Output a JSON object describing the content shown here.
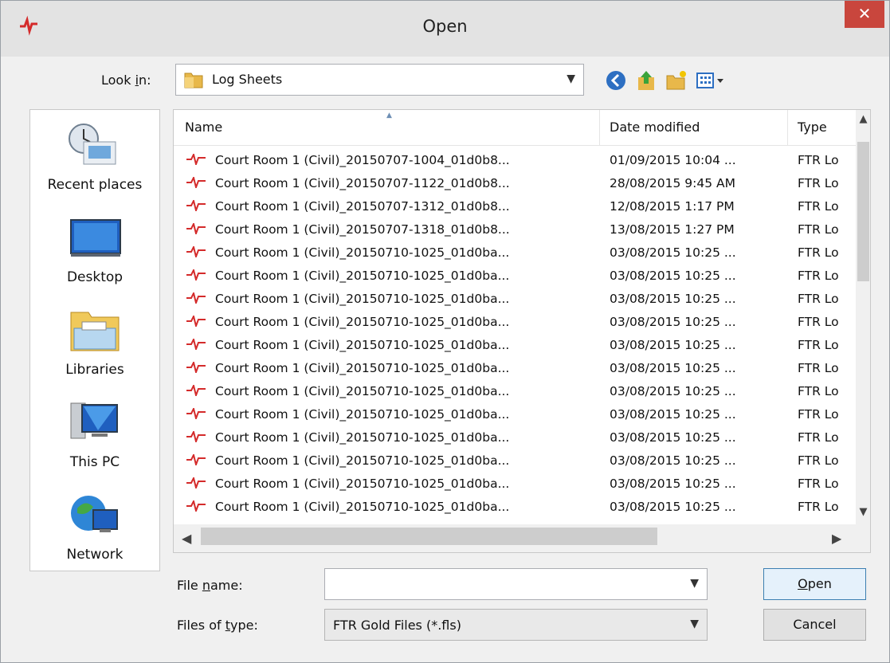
{
  "window": {
    "title": "Open",
    "close_label": "✕"
  },
  "look_in": {
    "label_pre": "Look ",
    "label_accel": "i",
    "label_post": "n:",
    "value": "Log Sheets"
  },
  "toolbar": {
    "back_icon": "back-arrow-icon",
    "up_icon": "up-folder-icon",
    "new_folder_icon": "new-folder-icon",
    "view_icon": "view-menu-icon"
  },
  "places": [
    {
      "label": "Recent places",
      "icon": "recent-places-icon"
    },
    {
      "label": "Desktop",
      "icon": "desktop-icon"
    },
    {
      "label": "Libraries",
      "icon": "libraries-icon"
    },
    {
      "label": "This PC",
      "icon": "this-pc-icon"
    },
    {
      "label": "Network",
      "icon": "network-icon"
    }
  ],
  "columns": {
    "name": "Name",
    "date": "Date modified",
    "type": "Type"
  },
  "files": [
    {
      "name": "Court Room 1 (Civil)_20150707-1004_01d0b8...",
      "date": "01/09/2015 10:04 ...",
      "type": "FTR Lo"
    },
    {
      "name": "Court Room 1 (Civil)_20150707-1122_01d0b8...",
      "date": "28/08/2015 9:45 AM",
      "type": "FTR Lo"
    },
    {
      "name": "Court Room 1 (Civil)_20150707-1312_01d0b8...",
      "date": "12/08/2015 1:17 PM",
      "type": "FTR Lo"
    },
    {
      "name": "Court Room 1 (Civil)_20150707-1318_01d0b8...",
      "date": "13/08/2015 1:27 PM",
      "type": "FTR Lo"
    },
    {
      "name": "Court Room 1 (Civil)_20150710-1025_01d0ba...",
      "date": "03/08/2015 10:25 ...",
      "type": "FTR Lo"
    },
    {
      "name": "Court Room 1 (Civil)_20150710-1025_01d0ba...",
      "date": "03/08/2015 10:25 ...",
      "type": "FTR Lo"
    },
    {
      "name": "Court Room 1 (Civil)_20150710-1025_01d0ba...",
      "date": "03/08/2015 10:25 ...",
      "type": "FTR Lo"
    },
    {
      "name": "Court Room 1 (Civil)_20150710-1025_01d0ba...",
      "date": "03/08/2015 10:25 ...",
      "type": "FTR Lo"
    },
    {
      "name": "Court Room 1 (Civil)_20150710-1025_01d0ba...",
      "date": "03/08/2015 10:25 ...",
      "type": "FTR Lo"
    },
    {
      "name": "Court Room 1 (Civil)_20150710-1025_01d0ba...",
      "date": "03/08/2015 10:25 ...",
      "type": "FTR Lo"
    },
    {
      "name": "Court Room 1 (Civil)_20150710-1025_01d0ba...",
      "date": "03/08/2015 10:25 ...",
      "type": "FTR Lo"
    },
    {
      "name": "Court Room 1 (Civil)_20150710-1025_01d0ba...",
      "date": "03/08/2015 10:25 ...",
      "type": "FTR Lo"
    },
    {
      "name": "Court Room 1 (Civil)_20150710-1025_01d0ba...",
      "date": "03/08/2015 10:25 ...",
      "type": "FTR Lo"
    },
    {
      "name": "Court Room 1 (Civil)_20150710-1025_01d0ba...",
      "date": "03/08/2015 10:25 ...",
      "type": "FTR Lo"
    },
    {
      "name": "Court Room 1 (Civil)_20150710-1025_01d0ba...",
      "date": "03/08/2015 10:25 ...",
      "type": "FTR Lo"
    },
    {
      "name": "Court Room 1 (Civil)_20150710-1025_01d0ba...",
      "date": "03/08/2015 10:25 ...",
      "type": "FTR Lo"
    }
  ],
  "file_name": {
    "label_pre": "File ",
    "label_accel": "n",
    "label_post": "ame:",
    "value": ""
  },
  "file_type": {
    "label_pre": "Files of ",
    "label_accel": "t",
    "label_post": "ype:",
    "value": "FTR Gold Files (*.fls)"
  },
  "buttons": {
    "open_accel": "O",
    "open_rest": "pen",
    "cancel": "Cancel"
  },
  "colors": {
    "close_button": "#c9463d",
    "app_icon": "#d42b2b",
    "folder": "#e8b84a",
    "selection_border": "#3c7fb1"
  }
}
